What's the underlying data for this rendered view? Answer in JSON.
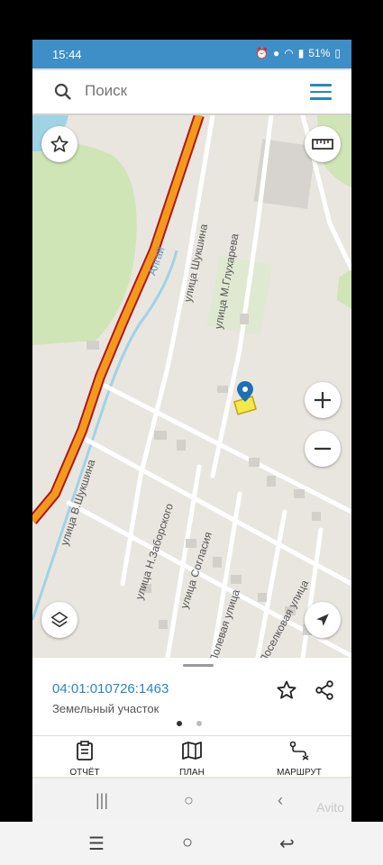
{
  "status_bar": {
    "time": "15:44",
    "battery": "51%"
  },
  "search": {
    "placeholder": "Поиск"
  },
  "map": {
    "road_labels": [
      "Алгай",
      "улица Шукшина",
      "улица М.Глухарева",
      "улица В.Шукшина",
      "улица Н.Заборского",
      "улица Согласия",
      "Полевая улица",
      "Поселковая улица"
    ]
  },
  "parcel": {
    "cadastral_number": "04:01:010726:1463",
    "type": "Земельный участок"
  },
  "actions": {
    "report": "ОТЧЁТ",
    "plan": "ПЛАН",
    "route": "МАРШРУТ"
  },
  "watermark": "Avito",
  "colors": {
    "accent": "#2a86c5",
    "status_bar": "#3e8fc7",
    "highway": "#f39a1c",
    "highway_border": "#b0171b"
  }
}
